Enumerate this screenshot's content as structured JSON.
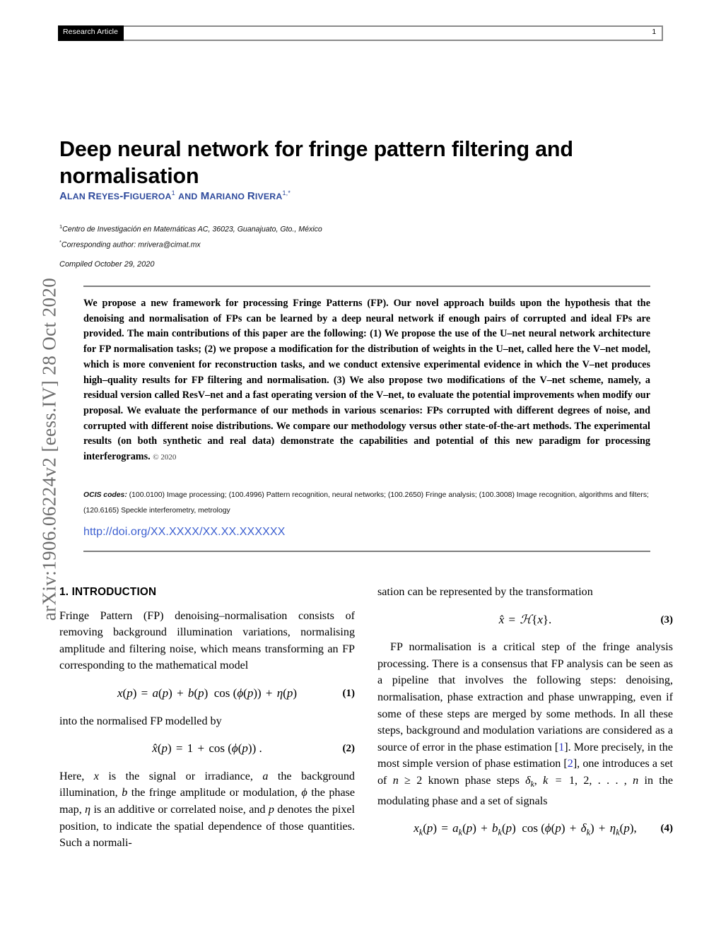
{
  "header": {
    "badge": "Research Article",
    "page_number": "1"
  },
  "arxiv_stamp": "arXiv:1906.06224v2  [eess.IV]  28 Oct 2020",
  "title": "Deep neural network for fringe pattern filtering and normalisation",
  "authors": {
    "line": "ALAN REYES-FIGUEROA1 AND MARIANO RIVERA1,*",
    "author1_first": "A",
    "author1_rest": "LAN ",
    "author1_last_first": "R",
    "author1_last_rest": "EYES",
    "author1_last2_first": "-F",
    "author1_last2_rest": "IGUEROA",
    "author1_sup": "1",
    "conjunction_first": "AND",
    "author2_first": "M",
    "author2_rest": "ARIANO ",
    "author2_last_first": "R",
    "author2_last_rest": "IVERA",
    "author2_sup": "1,*"
  },
  "affiliations": {
    "sup1": "1",
    "line1": "Centro de Investigación en Matemáticas AC, 36023, Guanajuato, Gto., México",
    "sup2": "*",
    "line2": "Corresponding author: mrivera@cimat.mx"
  },
  "compiled": "Compiled October 29, 2020",
  "abstract": {
    "text": "We propose a new framework for processing Fringe Patterns (FP). Our novel approach builds upon the hypothesis that the denoising and normalisation of FPs can be learned by a deep neural network if enough pairs of corrupted and ideal FPs are provided. The main contributions of this paper are the following: (1) We propose the use of the U–net neural network architecture for FP normalisation tasks; (2) we propose a modification for the distribution of weights in the U–net, called here the V–net model, which is more convenient for reconstruction tasks, and we conduct extensive experimental evidence in which the V–net produces high–quality results for FP filtering and normalisation. (3) We also propose two modifications of the V–net scheme, namely, a residual version called ResV–net and a fast operating version of the V–net, to evaluate the potential improvements when modify our proposal. We evaluate the performance of our methods in various scenarios: FPs corrupted with different degrees of noise, and corrupted with different noise distributions. We compare our methodology versus other state-of-the-art methods. The experimental results (on both synthetic and real data) demonstrate the capabilities and potential of this new paradigm for processing interferograms.",
    "copyright": "© 2020"
  },
  "ocis": {
    "label": "OCIS codes:",
    "text": "(100.0100) Image processing; (100.4996) Pattern recognition, neural networks; (100.2650) Fringe analysis; (100.3008) Image recognition, algorithms and filters; (120.6165) Speckle interferometry, metrology"
  },
  "doi": "http://doi.org/XX.XXXX/XX.XX.XXXXXX",
  "body": {
    "section1_heading": "1. INTRODUCTION",
    "left_para1": "Fringe Pattern (FP) denoising–normalisation consists of removing background illumination variations, normalising amplitude and filtering noise, which means transforming an FP corresponding to the mathematical model",
    "eq1_number": "(1)",
    "eq1_latex": "x(p) = a(p) + b(p) cos (ϕ(p)) + η(p)",
    "left_para2": "into the normalised FP modelled by",
    "eq2_number": "(2)",
    "eq2_latex": "x̂(p) = 1 + cos (ϕ(p)) .",
    "left_para3_a": "Here, ",
    "left_para3_b": " is the signal or irradiance, ",
    "left_para3_c": " the background illumination, ",
    "left_para3_d": " the fringe amplitude or modulation, ",
    "left_para3_e": " the phase map, ",
    "left_para3_f": " is an additive or correlated noise, and ",
    "left_para3_g": " denotes the pixel position, to indicate the spatial dependence of those quantities. Such a normali-",
    "right_para1": "sation can be represented by the transformation",
    "eq3_number": "(3)",
    "eq3_latex": "x̂ = ℋ{x}.",
    "right_para2_a": "FP normalisation is a critical step of the fringe analysis processing. There is a consensus that FP analysis can be seen as a pipeline that involves the following steps: denoising, normalisation, phase extraction and phase unwrapping, even if some of these steps are merged by some methods. In all these steps, background and modulation variations are considered as a source of error in the phase estimation [",
    "ref1": "1",
    "right_para2_b": "]. More precisely, in the most simple version of phase estimation [",
    "ref2": "2",
    "right_para2_c": "], one introduces a set of ",
    "right_para2_d": " ≥ 2 known phase steps ",
    "right_para2_e": " in the modulating phase and a set of signals",
    "eq4_number": "(4)",
    "eq4_latex": "x_k(p) = a_k(p) + b_k(p) cos (ϕ(p) + δ_k) + η_k(p),"
  },
  "colors": {
    "author_blue": "#2e4a9c",
    "link_blue": "#3c5fd0",
    "citation_blue": "#2b36c8",
    "rule_gray": "#7d7d7d",
    "badge_black": "#000000",
    "stamp_gray": "#6d6d6d"
  }
}
